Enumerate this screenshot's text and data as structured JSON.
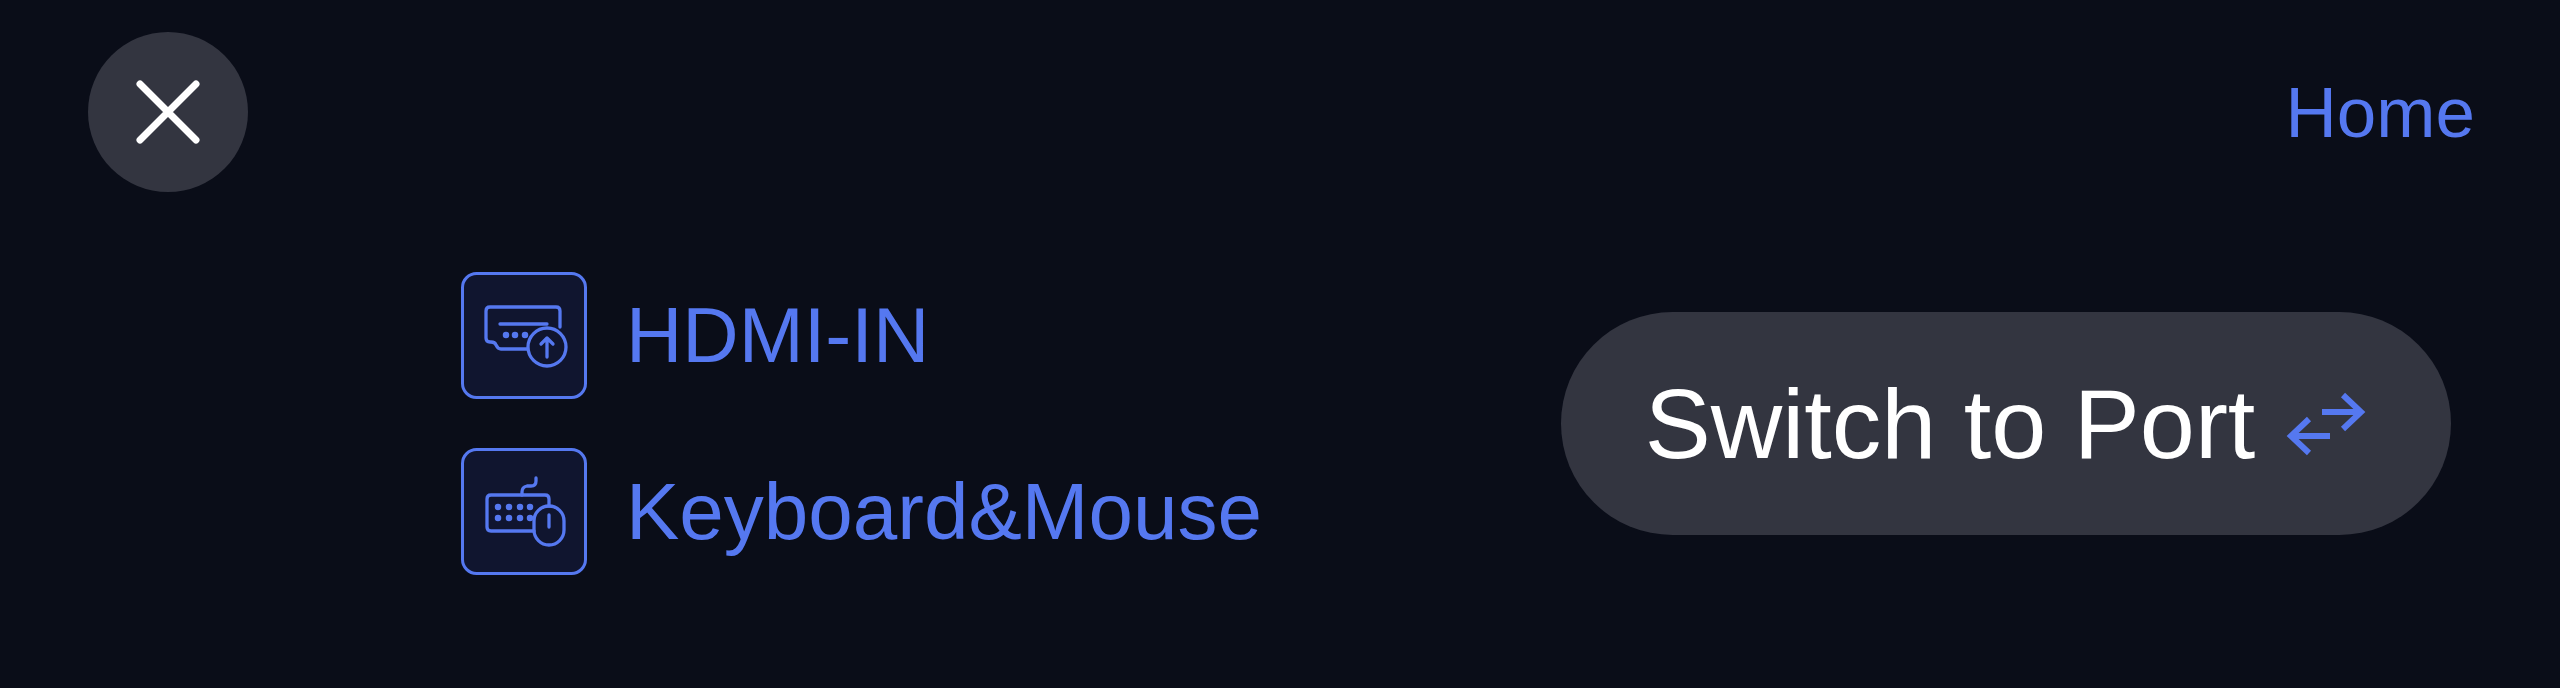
{
  "header": {
    "home_link": "Home"
  },
  "ports": [
    {
      "kind": "hdmi",
      "label": "HDMI-IN"
    },
    {
      "kind": "keyboard-mouse",
      "label": "Keyboard&Mouse"
    }
  ],
  "switch_button": {
    "label": "Switch to Port"
  }
}
